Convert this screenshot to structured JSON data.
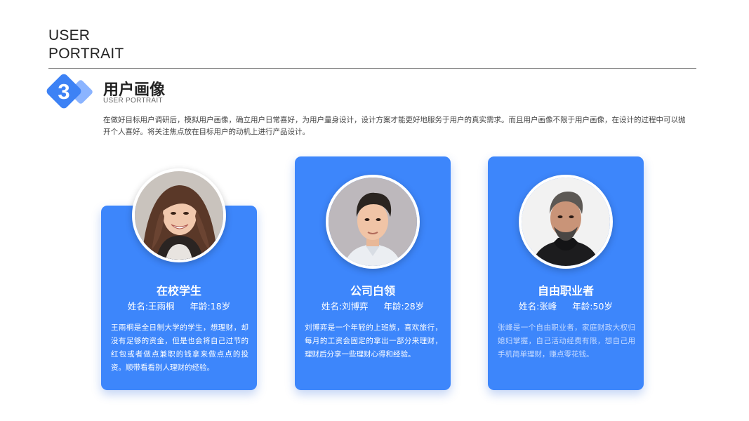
{
  "header": {
    "title_line1": "USER",
    "title_line2": "PORTRAIT"
  },
  "section": {
    "number": "3",
    "title": "用户画像",
    "subtitle": "USER PORTRAIT",
    "intro": "在做好目标用户调研后，模拟用户画像，确立用户日常喜好，为用户量身设计，设计方案才能更好地服务于用户的真实需求。而且用户画像不限于用户画像，在设计的过程中可以抛开个人喜好。将关注焦点放在目标用户的动机上进行产品设计。"
  },
  "colors": {
    "accent": "#3d86fb",
    "badge_front": "#3d82f5",
    "badge_back": "#8bb4ff"
  },
  "personas": [
    {
      "avatar": "female-student-avatar",
      "role": "在校学生",
      "name": "姓名:王雨桐",
      "age": "年龄:18岁",
      "description": "王雨桐是全日制大学的学生，想理财，却没有足够的资金，但是也会将自己过节的红包或者做点兼职的钱拿来做点点的投资。顺带看看别人理财的经验。"
    },
    {
      "avatar": "young-man-avatar",
      "role": "公司白领",
      "name": "姓名:刘博弈",
      "age": "年龄:28岁",
      "description": "刘博弈是一个年轻的上班族，喜欢旅行，每月的工资会固定的拿出一部分来理财，理财后分享一些理财心得和经验。"
    },
    {
      "avatar": "middle-aged-man-avatar",
      "role": "自由职业者",
      "name": "姓名:张峰",
      "age": "年龄:50岁",
      "description": "张峰是一个自由职业者，家庭财政大权归媳妇掌握，自己活动经费有限，想自己用手机简单理财，赚点零花钱。"
    }
  ]
}
